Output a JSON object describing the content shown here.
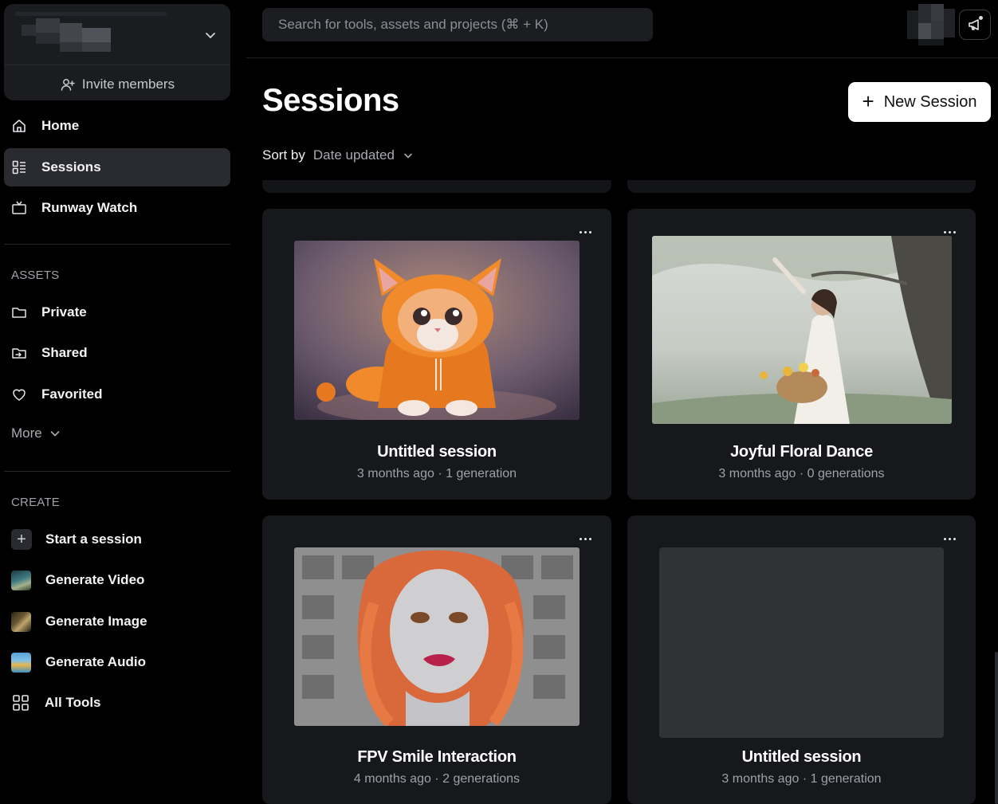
{
  "workspace": {
    "invite_label": "Invite members"
  },
  "search": {
    "placeholder": "Search for tools, assets and projects (⌘ + K)"
  },
  "nav": {
    "home": "Home",
    "sessions": "Sessions",
    "runway_watch": "Runway Watch"
  },
  "assets": {
    "section_label": "ASSETS",
    "private": "Private",
    "shared": "Shared",
    "favorited": "Favorited",
    "more": "More"
  },
  "create": {
    "section_label": "CREATE",
    "start_session": "Start a session",
    "generate_video": "Generate Video",
    "generate_image": "Generate Image",
    "generate_audio": "Generate Audio",
    "all_tools": "All Tools"
  },
  "main": {
    "title": "Sessions",
    "new_session_label": "New Session",
    "sort_label": "Sort by",
    "sort_value": "Date updated"
  },
  "cards": [
    {
      "title": "Untitled session",
      "meta": "3 months ago · 1 generation"
    },
    {
      "title": "Joyful Floral Dance",
      "meta": "3 months ago · 0 generations"
    },
    {
      "title": "FPV Smile Interaction",
      "meta": "4 months ago · 2 generations"
    },
    {
      "title": "Untitled session",
      "meta": "3 months ago · 1 generation"
    }
  ],
  "colors": {
    "background": "#000000",
    "sidebar_card": "#1b1c20",
    "active_nav": "#2a2b30",
    "card": "#17181b",
    "button_primary": "#ffffff"
  }
}
